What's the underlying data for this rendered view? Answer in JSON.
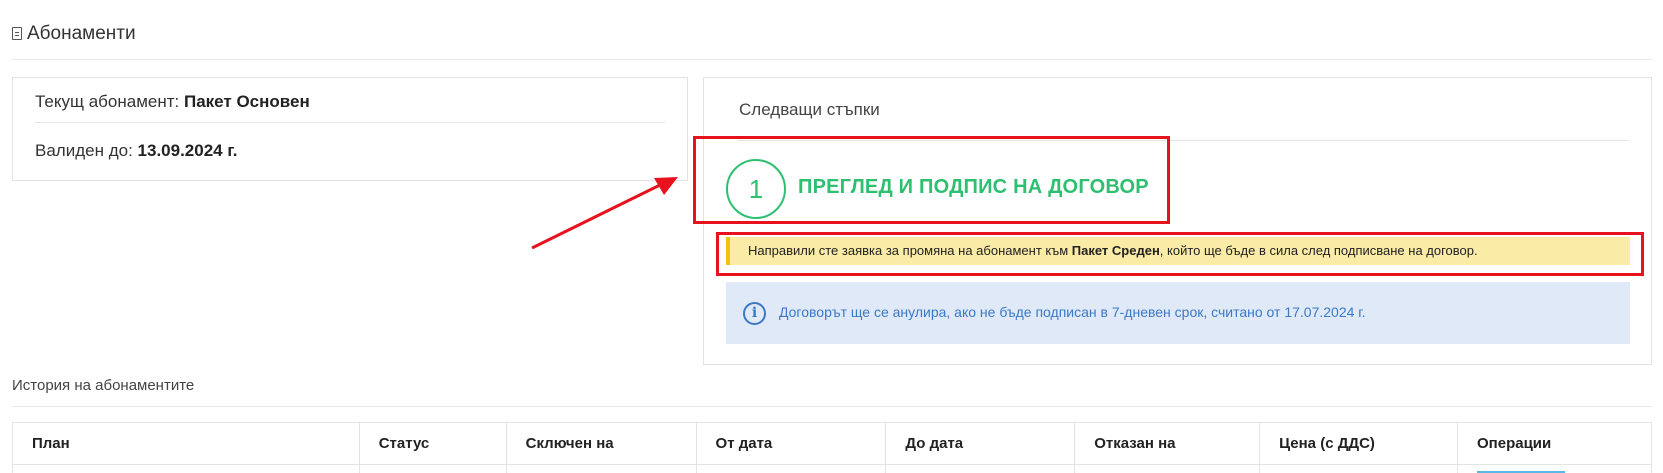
{
  "header": {
    "title": "Абонаменти",
    "icon": "document-icon"
  },
  "current_subscription": {
    "label": "Текущ абонамент:",
    "plan": "Пакет Основен",
    "valid_label": "Валиден до:",
    "valid_date": "13.09.2024 г."
  },
  "next_steps": {
    "title": "Следващи стъпки",
    "step_number": "1",
    "step_title": "ПРЕГЛЕД И ПОДПИС НА ДОГОВОР",
    "warning": {
      "before": "Направили сте заявка за промяна на абонамент към",
      "plan": "Пакет Среден",
      "after": ", който ще бъде в сила след подписване на договор."
    },
    "info": {
      "icon": "info-icon",
      "text": "Договорът ще се анулира, ако не бъде подписан в 7-дневен срок, считано от 17.07.2024 г."
    }
  },
  "history": {
    "title": "История на абонаментите",
    "columns": [
      "План",
      "Статус",
      "Сключен на",
      "От дата",
      "До дата",
      "Отказан на",
      "Цена (с ДДС)",
      "Операции"
    ]
  },
  "annotations": {
    "highlight_color": "#e8121e"
  },
  "colors": {
    "step_green": "#2fbf71",
    "info_blue": "#3b79c7",
    "warning_bg": "#faeba6"
  }
}
